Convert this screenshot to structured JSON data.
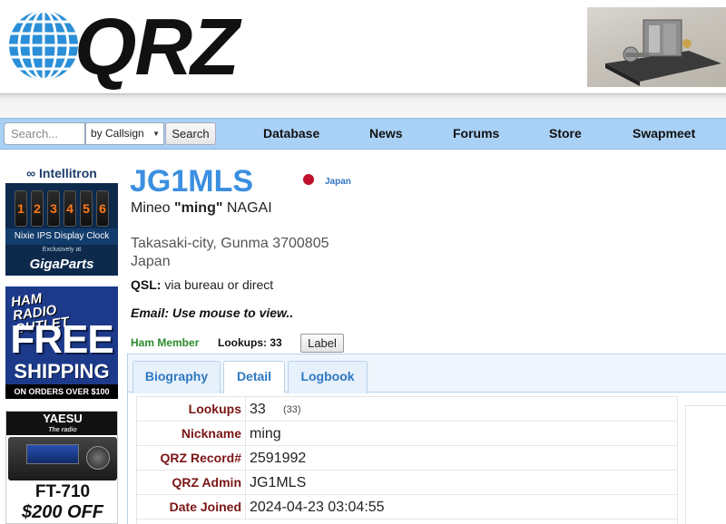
{
  "header": {
    "logo_text": "QRZ"
  },
  "search": {
    "placeholder": "Search...",
    "mode": "by Callsign",
    "button": "Search"
  },
  "nav": {
    "items": [
      "Database",
      "News",
      "Forums",
      "Store",
      "Swapmeet"
    ]
  },
  "ads": {
    "ad1": {
      "brand": "Intellitron",
      "caption": "Nixie IPS Display Clock",
      "exclusive": "Exclusively at",
      "store": "GigaParts"
    },
    "ad2": {
      "line1": "HAM",
      "line2": "RADIO",
      "line3": "OUTLET",
      "free": "FREE",
      "shipping": "SHIPPING",
      "orders": "ON ORDERS OVER $100"
    },
    "ad3": {
      "brand": "YAESU",
      "tagline": "The radio",
      "model": "FT-710",
      "offer": "$200 OFF"
    }
  },
  "profile": {
    "callsign": "JG1MLS",
    "country": "Japan",
    "name_first": "Mineo ",
    "name_nick": "\"ming\"",
    "name_last": " NAGAI",
    "address_line1": "Takasaki-city, Gunma 3700805",
    "address_line2": "Japan",
    "qsl_label": "QSL:",
    "qsl_value": " via bureau or direct",
    "email": "Email: Use mouse to view..",
    "member": "Ham Member",
    "lookups": "Lookups: 33",
    "label_button": "Label"
  },
  "tabs": [
    "Biography",
    "Detail",
    "Logbook"
  ],
  "details": [
    {
      "key": "Lookups",
      "value": "33",
      "sub": "(33)"
    },
    {
      "key": "Nickname",
      "value": "ming"
    },
    {
      "key": "QRZ Record#",
      "value": "2591992"
    },
    {
      "key": "QRZ Admin",
      "value": "JG1MLS"
    },
    {
      "key": "Date Joined",
      "value": "2024-04-23 03:04:55"
    }
  ],
  "colors": {
    "callsign": "#3b8fe0",
    "navbar": "#a9d1f6",
    "detail_key": "#7a1515",
    "member": "#2b8a2b"
  }
}
